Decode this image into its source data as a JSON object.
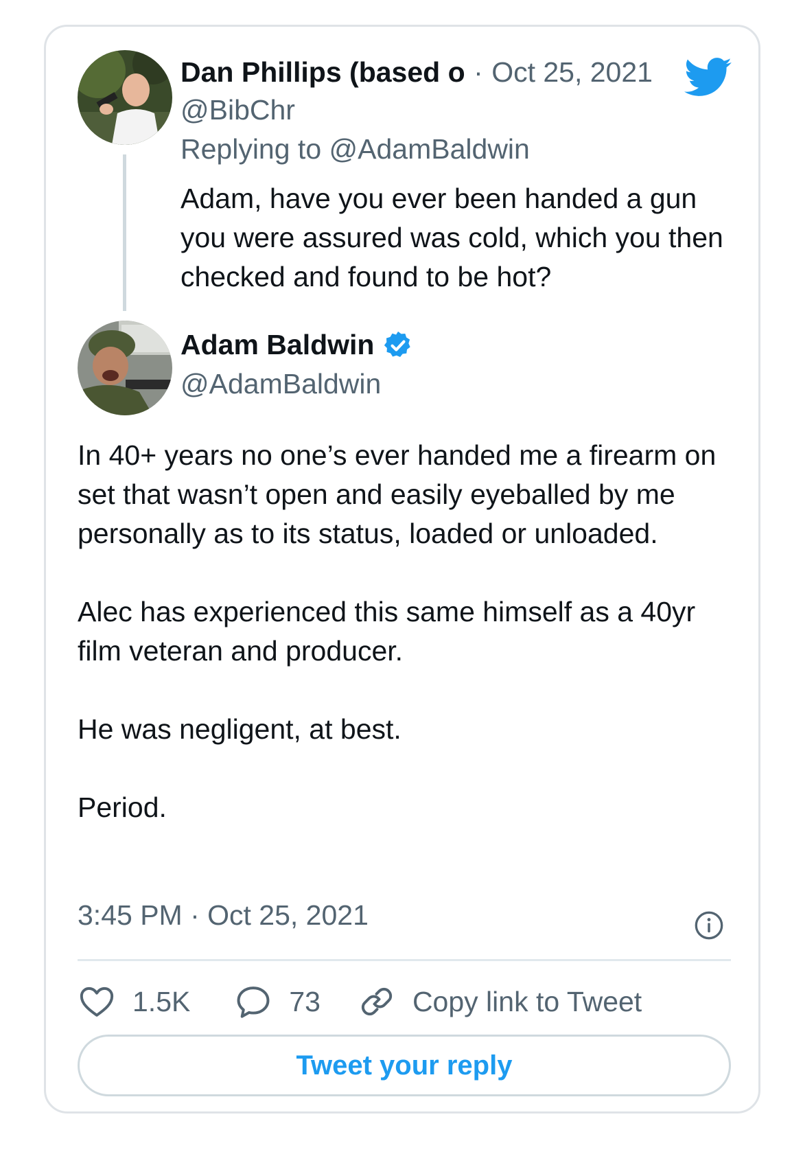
{
  "parent_tweet": {
    "display_name": "Dan Phillips (based o",
    "separator": "·",
    "date": "Oct 25, 2021",
    "handle": "@BibChr",
    "replying_prefix": "Replying to",
    "replying_to": "@AdamBaldwin",
    "text": "Adam, have you ever been handed a gun you were assured was cold, which you then checked and found to be hot?"
  },
  "main_tweet": {
    "display_name": "Adam Baldwin",
    "handle": "@AdamBaldwin",
    "paragraphs": [
      "In 40+ years no one’s ever handed me a firearm on set that wasn’t open and easily eyeballed by me personally as to its status, loaded or unloaded.",
      "Alec has experienced this same himself as a 40yr film veteran and producer.",
      "He was negligent, at best.",
      "Period."
    ],
    "timestamp": "3:45 PM · Oct 25, 2021"
  },
  "actions": {
    "likes": "1.5K",
    "replies": "73",
    "copy_link_label": "Copy link to Tweet"
  },
  "reply_button_label": "Tweet your reply",
  "icons": {
    "logo": "twitter-bird-icon",
    "verified": "verified-badge-icon",
    "info": "info-icon",
    "like": "heart-icon",
    "reply": "speech-bubble-icon",
    "link": "link-icon"
  },
  "colors": {
    "accent": "#1d9bf0",
    "text": "#0f1419",
    "muted": "#536471",
    "border": "#dfe3e7"
  }
}
